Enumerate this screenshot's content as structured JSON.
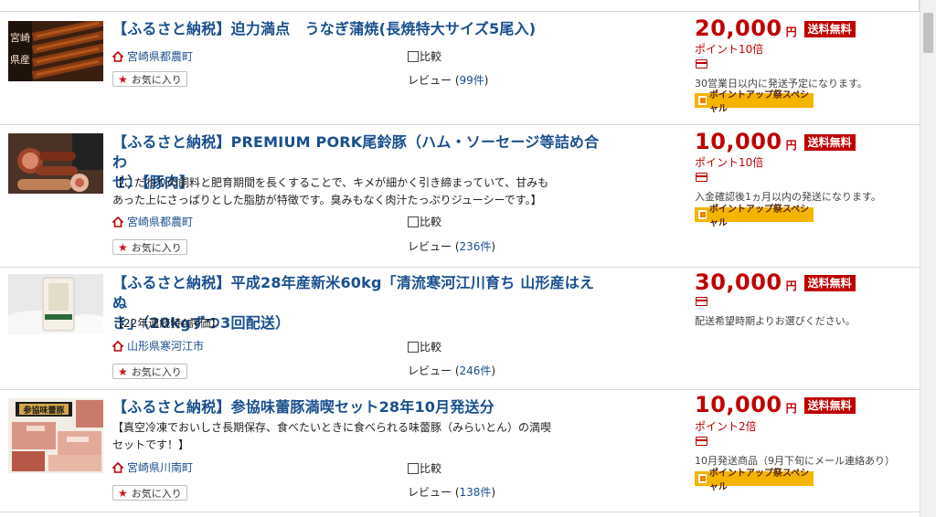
{
  "items": [
    {
      "title": "【ふるさと納税】迫力満点　うなぎ蒲焼(長焼特大サイズ5尾入)",
      "title_line2": "",
      "desc_line1": "",
      "desc_line2": "",
      "location": "宮崎県都農町",
      "compare": "比較",
      "favorite": "お気に入り",
      "review_label": "レビュー",
      "review_count": "99件",
      "price": "20,000",
      "yen": "円",
      "shipping": "送料無料",
      "points": "ポイント10倍",
      "ship_note": "30営業日以内に発送予定になります。",
      "campaign": "ポイントアップ祭スペシャル",
      "thumb_text": "宮崎県産"
    },
    {
      "title": "【ふるさと納税】PREMIUM PORK尾鈴豚（ハム・ソーセージ等詰め合わ",
      "title_line2": "せ）【豚肉】",
      "desc_line1": "【こだわりの飼料と肥育期間を長くすることで、キメが細かく引き締まっていて、甘みも",
      "desc_line2": "あった上にさっぱりとした脂肪が特徴です。臭みもなく肉汁たっぷりジューシーです。】",
      "location": "宮崎県都農町",
      "compare": "比較",
      "favorite": "お気に入り",
      "review_label": "レビュー",
      "review_count": "236件",
      "price": "10,000",
      "yen": "円",
      "shipping": "送料無料",
      "points": "ポイント10倍",
      "ship_note": "入金確認後1ヵ月以内の発送になります。",
      "campaign": "ポイントアップ祭スペシャル"
    },
    {
      "title": "【ふるさと納税】平成28年産新米60kg「清流寒河江川育ち 山形産はえぬ",
      "title_line2": "き」（20kgずつ3回配送）",
      "desc_line1": "【22年連続特A評価】",
      "desc_line2": "",
      "location": "山形県寒河江市",
      "compare": "比較",
      "favorite": "お気に入り",
      "review_label": "レビュー",
      "review_count": "246件",
      "price": "30,000",
      "yen": "円",
      "shipping": "送料無料",
      "points": "",
      "ship_note": "配送希望時期よりお選びください。",
      "campaign": ""
    },
    {
      "title": "【ふるさと納税】参協味蕾豚満喫セット28年10月発送分",
      "title_line2": "",
      "desc_line1": "【真空冷凍でおいしさ長期保存、食べたいときに食べられる味蕾豚（みらいとん）の満喫",
      "desc_line2": "セットです！】",
      "location": "宮崎県川南町",
      "compare": "比較",
      "favorite": "お気に入り",
      "review_label": "レビュー",
      "review_count": "138件",
      "price": "10,000",
      "yen": "円",
      "shipping": "送料無料",
      "points": "ポイント2倍",
      "ship_note": "10月発送商品（9月下旬にメール連絡あり）",
      "campaign": "ポイントアップ祭スペシャル",
      "thumb_text": "参協味蕾豚"
    }
  ],
  "colors": {
    "price_red": "#bf0000",
    "link_blue": "#1a4f8f",
    "campaign_yellow": "#f4b400"
  }
}
